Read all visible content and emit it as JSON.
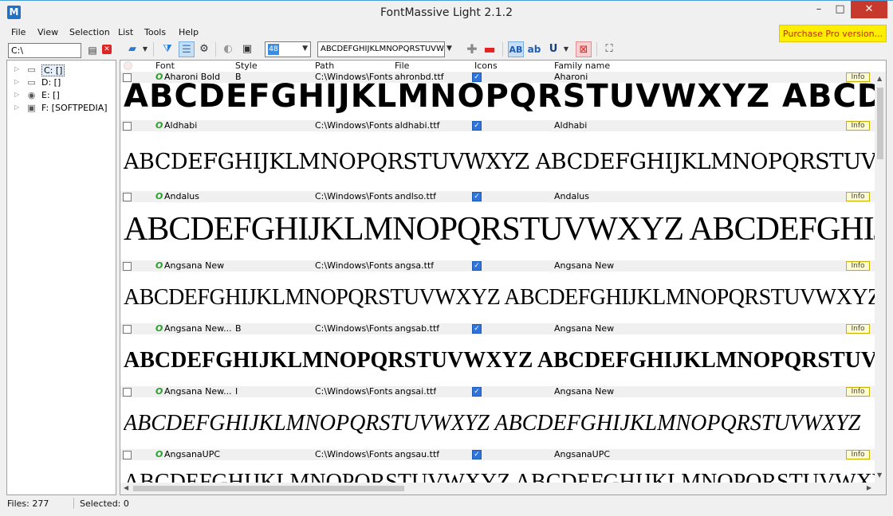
{
  "window": {
    "title": "FontMassive Light 2.1.2",
    "app_icon": "M",
    "minimize": "–",
    "maximize": "□",
    "close": "✕"
  },
  "menu": {
    "items": [
      "File",
      "View",
      "Selection",
      "List",
      "Tools",
      "Help"
    ],
    "purchase": "Purchase Pro version..."
  },
  "path": {
    "value": "C:\\",
    "go_icon": "list-go-icon",
    "clear_icon": "clear-icon"
  },
  "tree": {
    "items": [
      {
        "label": "C: []",
        "icon": "hard-drive-icon",
        "selected": true
      },
      {
        "label": "D: []",
        "icon": "hard-drive-icon",
        "selected": false
      },
      {
        "label": "E: []",
        "icon": "cd-drive-icon",
        "selected": false
      },
      {
        "label": "F: [SOFTPEDIA]",
        "icon": "network-drive-icon",
        "selected": false
      }
    ]
  },
  "toolbar": {
    "size_value": "48",
    "sample_text": "ABCDEFGHIJKLMNOPQRSTUVWXYZ",
    "bold_label": "AB",
    "lower_label": "ab",
    "underline_label": "U"
  },
  "list": {
    "columns": [
      "Font",
      "Style",
      "Path",
      "File",
      "Icons",
      "Family name"
    ],
    "info_label": "Info",
    "sample_text": "ABCDEFGHIJKLMNOPQRSTUVWXYZ ABCDEFGHIJKLMNOPQRSTUVWXYZ",
    "rows": [
      {
        "font": "Aharoni Bold",
        "style": "B",
        "path": "C:\\Windows\\Fonts",
        "file": "ahronbd.ttf",
        "icons": true,
        "family": "Aharoni"
      },
      {
        "font": "Aldhabi",
        "style": "",
        "path": "C:\\Windows\\Fonts",
        "file": "aldhabi.ttf",
        "icons": true,
        "family": "Aldhabi"
      },
      {
        "font": "Andalus",
        "style": "",
        "path": "C:\\Windows\\Fonts",
        "file": "andlso.ttf",
        "icons": true,
        "family": "Andalus"
      },
      {
        "font": "Angsana New",
        "style": "",
        "path": "C:\\Windows\\Fonts",
        "file": "angsa.ttf",
        "icons": true,
        "family": "Angsana New"
      },
      {
        "font": "Angsana New...",
        "style": "B",
        "path": "C:\\Windows\\Fonts",
        "file": "angsab.ttf",
        "icons": true,
        "family": "Angsana New"
      },
      {
        "font": "Angsana New...",
        "style": "I",
        "path": "C:\\Windows\\Fonts",
        "file": "angsai.ttf",
        "icons": true,
        "family": "Angsana New"
      },
      {
        "font": "AngsanaUPC",
        "style": "",
        "path": "C:\\Windows\\Fonts",
        "file": "angsau.ttf",
        "icons": true,
        "family": "AngsanaUPC"
      }
    ]
  },
  "status": {
    "files": "Files: 277",
    "selected": "Selected: 0"
  }
}
